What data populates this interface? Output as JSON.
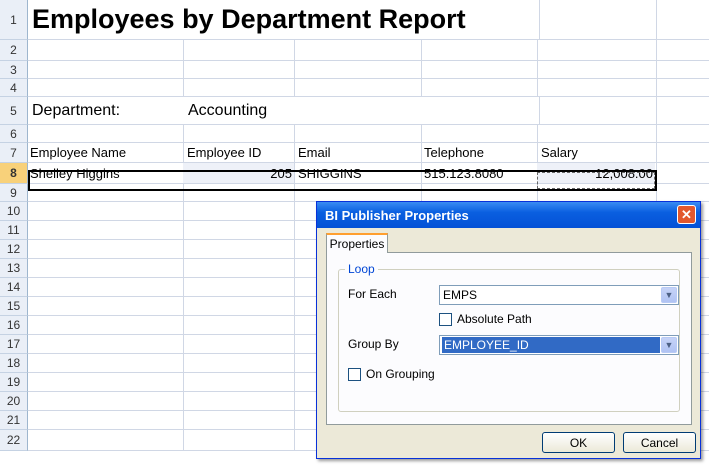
{
  "sheet": {
    "row_numbers": [
      "1",
      "2",
      "3",
      "4",
      "5",
      "6",
      "7",
      "8",
      "9",
      "10",
      "11",
      "12",
      "13",
      "14",
      "15",
      "16",
      "17",
      "18",
      "19",
      "20",
      "21",
      "22"
    ],
    "selected_row": "8",
    "title": "Employees by Department Report",
    "department_label": "Department:",
    "department_value": "Accounting",
    "headers": {
      "name": "Employee Name",
      "id": "Employee ID",
      "email": "Email",
      "telephone": "Telephone",
      "salary": "Salary"
    },
    "row8": {
      "name": "Shelley Higgins",
      "id": "205",
      "email": "SHIGGINS",
      "telephone": "515.123.8080",
      "salary": "12,008.00"
    }
  },
  "dialog": {
    "title": "BI Publisher Properties",
    "tab_label": "Properties",
    "group_label": "Loop",
    "for_each_label": "For Each",
    "for_each_value": "EMPS",
    "absolute_path_label": "Absolute Path",
    "group_by_label": "Group By",
    "group_by_value": "EMPLOYEE_ID",
    "on_grouping_label": "On Grouping",
    "ok_label": "OK",
    "cancel_label": "Cancel",
    "close_glyph": "✕",
    "dropdown_glyph": "▼",
    "titlebar_color": "#0a5fe0",
    "selection_color": "#316ac5"
  }
}
